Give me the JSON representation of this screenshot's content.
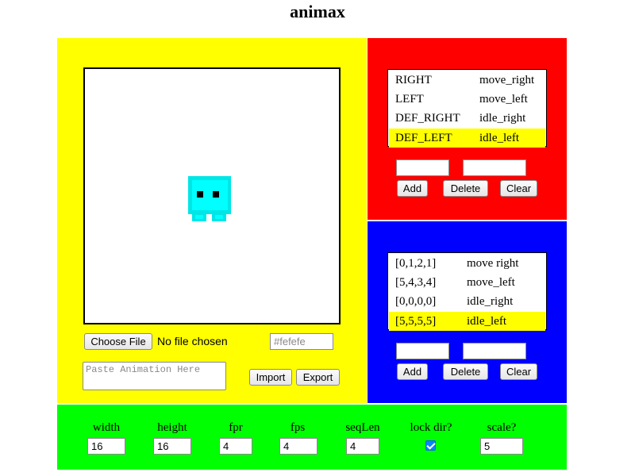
{
  "app": {
    "title": "animax"
  },
  "editor": {
    "choose_file_label": "Choose File",
    "no_file_label": "No file chosen",
    "bg_color_placeholder": "#fefefe",
    "paste_placeholder": "Paste Animation Here",
    "import_label": "Import",
    "export_label": "Export",
    "canvas_background": "#ffffff",
    "sprite_color": "#00ffff"
  },
  "key_bindings": {
    "rows": [
      {
        "key": "RIGHT",
        "animation": "move_right",
        "selected": false
      },
      {
        "key": "LEFT",
        "animation": "move_left",
        "selected": false
      },
      {
        "key": "DEF_RIGHT",
        "animation": "idle_right",
        "selected": false
      },
      {
        "key": "DEF_LEFT",
        "animation": "idle_left",
        "selected": true
      }
    ],
    "add_label": "Add",
    "delete_label": "Delete",
    "clear_label": "Clear",
    "panel_color": "#ff0000"
  },
  "sequences": {
    "rows": [
      {
        "frames": "[0,1,2,1]",
        "animation": "move right",
        "selected": false
      },
      {
        "frames": "[5,4,3,4]",
        "animation": "move_left",
        "selected": false
      },
      {
        "frames": "[0,0,0,0]",
        "animation": "idle_right",
        "selected": false
      },
      {
        "frames": "[5,5,5,5]",
        "animation": "idle_left",
        "selected": true
      }
    ],
    "add_label": "Add",
    "delete_label": "Delete",
    "clear_label": "Clear",
    "panel_color": "#0000ff"
  },
  "settings": {
    "width_label": "width",
    "width_value": "16",
    "height_label": "height",
    "height_value": "16",
    "fpr_label": "fpr",
    "fpr_value": "4",
    "fps_label": "fps",
    "fps_value": "4",
    "seqlen_label": "seqLen",
    "seqlen_value": "4",
    "lock_dir_label": "lock dir?",
    "lock_dir_checked": true,
    "scale_label": "scale?",
    "scale_value": "5",
    "panel_color": "#00ff00"
  },
  "colors": {
    "selection": "#ffff00",
    "checkbox_accent": "#0a84ff"
  }
}
